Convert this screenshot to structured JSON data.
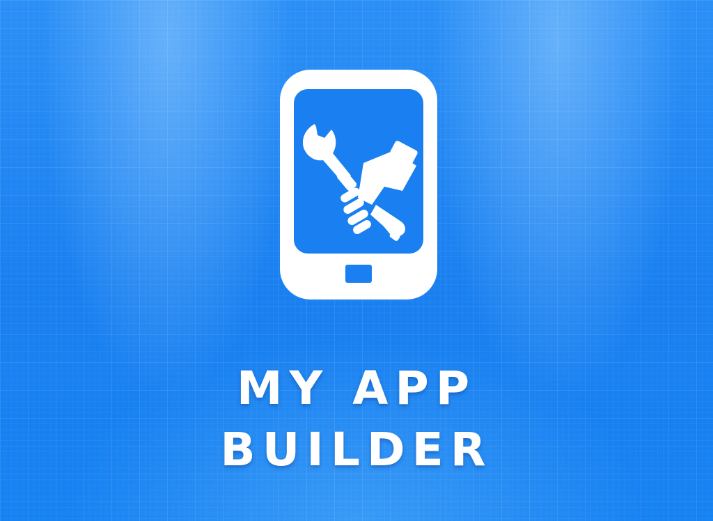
{
  "colors": {
    "background": "#1f86f2",
    "screen_blue": "#1a7ff0",
    "white": "#ffffff"
  },
  "icons": {
    "device": "smartphone-icon",
    "tool": "hand-holding-wrench-icon"
  },
  "title": {
    "line1": "MY APP",
    "line2": "BUILDER"
  }
}
